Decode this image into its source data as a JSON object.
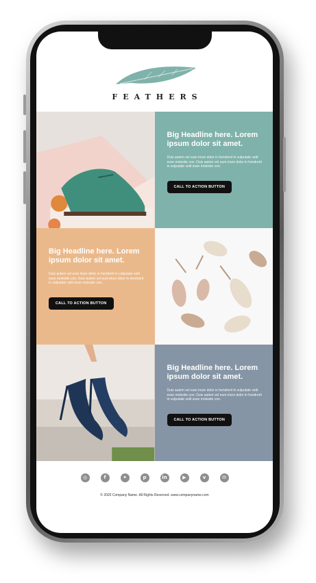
{
  "brand": {
    "name": "FEATHERS",
    "accent": "#7fb2aa"
  },
  "rows": [
    {
      "headline": "Big Headline here. Lorem ipsum dolor sit amet.",
      "body": "Duis autem vel eum iriure dolor in hendrerit in vulputate velit esse molestie con. Duis autem vel eum iriure dolor in hendrerit in vulputate velit esse molestie con.",
      "cta": "CALL TO ACTION BUTTON",
      "color": "#7fb2aa"
    },
    {
      "headline": "Big Headline here. Lorem ipsum dolor sit amet.",
      "body": "Duis autem vel eum iriure dolor in hendrerit in vulputate velit esse molestie con. Duis autem vel eum iriure dolor in hendrerit in vulputate velit esse molestie con.",
      "cta": "CALL TO ACTION BUTTON",
      "color": "#eab98b"
    },
    {
      "headline": "Big Headline here. Lorem ipsum dolor sit amet.",
      "body": "Duis autem vel eum iriure dolor in hendrerit in vulputate velit esse molestie con. Duis autem vel eum iriure dolor in hendrerit in vulputate velit esse molestie con.",
      "cta": "CALL TO ACTION BUTTON",
      "color": "#8595a5"
    }
  ],
  "social_icons": [
    "instagram-icon",
    "facebook-icon",
    "twitter-icon",
    "pinterest-icon",
    "linkedin-icon",
    "youtube-icon",
    "vimeo-icon",
    "email-icon"
  ],
  "footer": {
    "copyright": "© 2020 Company Name. All Rights Reserved. www.companyname.com"
  }
}
